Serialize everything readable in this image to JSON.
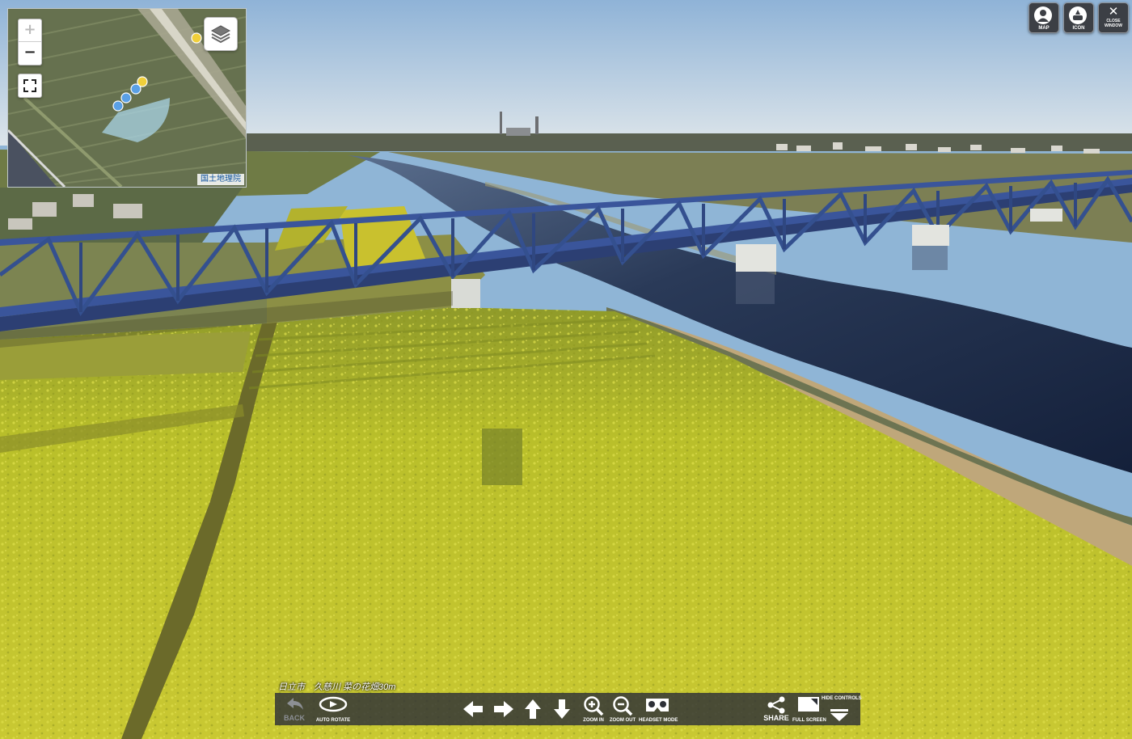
{
  "minimap": {
    "zoom_in_label": "+",
    "zoom_out_label": "−",
    "attribution": "国土地理院"
  },
  "top_buttons": [
    {
      "label": "MAP",
      "icon": "map-pin-icon"
    },
    {
      "label": "ICON",
      "icon": "hide-icons-icon"
    },
    {
      "label": "CLOSE WINDOW",
      "icon": "close-icon",
      "symbol": "✕"
    }
  ],
  "caption": "日立市　久慈川 菜の花畑30m",
  "controls": {
    "back": "BACK",
    "auto_rotate": "AUTO ROTATE",
    "zoom_in": "ZOOM IN",
    "zoom_out": "ZOOM OUT",
    "headset_mode": "HEADSET MODE",
    "share": "SHARE",
    "full_screen": "FULL SCREEN",
    "hide_controls": "HIDE CONTROLS"
  },
  "colors": {
    "bridge": "#34508f",
    "field": "#c2c52a",
    "river": "#1d2a42",
    "sky": "#b9cfe3"
  }
}
